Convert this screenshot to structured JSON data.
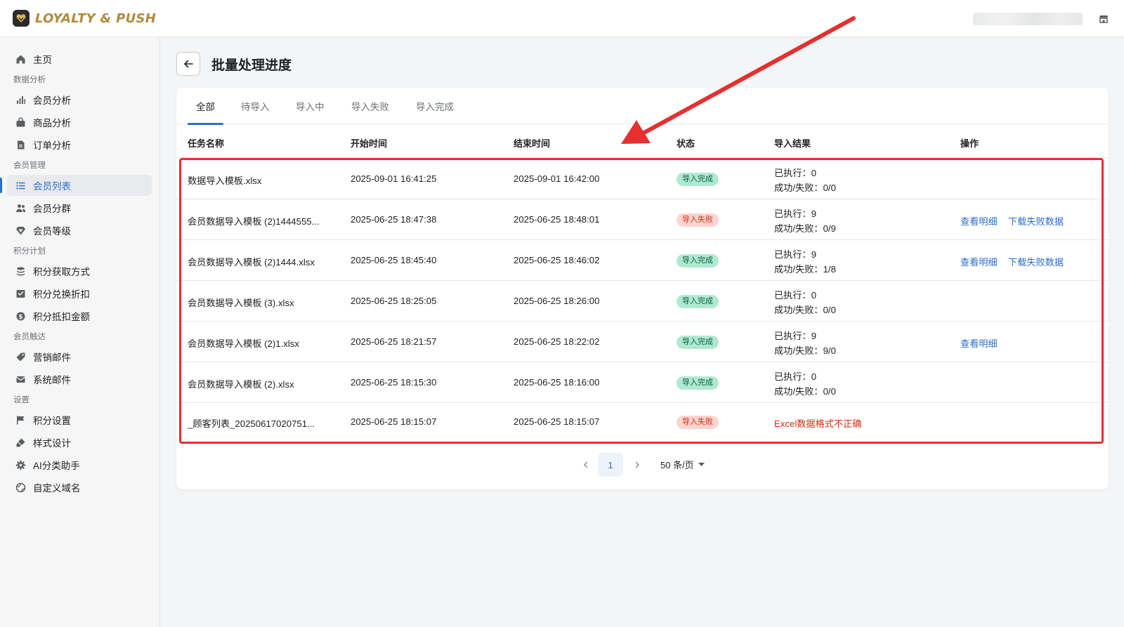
{
  "app": {
    "logo_text": "LOYALTY & PUSH",
    "user_name_redacted": ""
  },
  "sidebar": {
    "items": [
      {
        "label": "主页",
        "icon": "home-icon"
      },
      {
        "group": "数据分析"
      },
      {
        "label": "会员分析",
        "icon": "bar-chart-icon"
      },
      {
        "label": "商品分析",
        "icon": "bag-icon"
      },
      {
        "label": "订单分析",
        "icon": "document-icon"
      },
      {
        "group": "会员管理"
      },
      {
        "label": "会员列表",
        "icon": "list-icon",
        "active": true
      },
      {
        "label": "会员分群",
        "icon": "users-icon"
      },
      {
        "label": "会员等级",
        "icon": "diamond-icon"
      },
      {
        "group": "积分计划"
      },
      {
        "label": "积分获取方式",
        "icon": "stack-icon"
      },
      {
        "label": "积分兑换折扣",
        "icon": "inbox-icon"
      },
      {
        "label": "积分抵扣金额",
        "icon": "dollar-icon"
      },
      {
        "group": "会员触达"
      },
      {
        "label": "营销邮件",
        "icon": "tag-icon"
      },
      {
        "label": "系统邮件",
        "icon": "mail-icon"
      },
      {
        "group": "设置"
      },
      {
        "label": "积分设置",
        "icon": "flag-icon"
      },
      {
        "label": "样式设计",
        "icon": "brush-icon"
      },
      {
        "label": "AI分类助手",
        "icon": "gear-icon"
      },
      {
        "label": "自定义域名",
        "icon": "globe-icon"
      }
    ]
  },
  "page": {
    "title": "批量处理进度"
  },
  "tabs": [
    {
      "label": "全部",
      "active": true
    },
    {
      "label": "待导入"
    },
    {
      "label": "导入中"
    },
    {
      "label": "导入失败"
    },
    {
      "label": "导入完成"
    }
  ],
  "table": {
    "columns": [
      "任务名称",
      "开始时间",
      "结束时间",
      "状态",
      "导入结果",
      "操作"
    ],
    "rows": [
      {
        "name": "数据导入模板.xlsx",
        "start": "2025-09-01 16:41:25",
        "end": "2025-09-01 16:42:00",
        "status": "导入完成",
        "status_type": "ok",
        "executed": "已执行：0",
        "success_fail": "成功/失败：0/0",
        "actions": []
      },
      {
        "name": "会员数据导入模板 (2)1444555...",
        "start": "2025-06-25 18:47:38",
        "end": "2025-06-25 18:48:01",
        "status": "导入失败",
        "status_type": "fail",
        "executed": "已执行：9",
        "success_fail": "成功/失败：0/9",
        "actions": [
          "查看明细",
          "下载失败数据"
        ]
      },
      {
        "name": "会员数据导入模板 (2)1444.xlsx",
        "start": "2025-06-25 18:45:40",
        "end": "2025-06-25 18:46:02",
        "status": "导入完成",
        "status_type": "ok",
        "executed": "已执行：9",
        "success_fail": "成功/失败：1/8",
        "actions": [
          "查看明细",
          "下载失败数据"
        ]
      },
      {
        "name": "会员数据导入模板 (3).xlsx",
        "start": "2025-06-25 18:25:05",
        "end": "2025-06-25 18:26:00",
        "status": "导入完成",
        "status_type": "ok",
        "executed": "已执行：0",
        "success_fail": "成功/失败：0/0",
        "actions": []
      },
      {
        "name": "会员数据导入模板 (2)1.xlsx",
        "start": "2025-06-25 18:21:57",
        "end": "2025-06-25 18:22:02",
        "status": "导入完成",
        "status_type": "ok",
        "executed": "已执行：9",
        "success_fail": "成功/失败：9/0",
        "actions": [
          "查看明细"
        ]
      },
      {
        "name": "会员数据导入模板 (2).xlsx",
        "start": "2025-06-25 18:15:30",
        "end": "2025-06-25 18:16:00",
        "status": "导入完成",
        "status_type": "ok",
        "executed": "已执行：0",
        "success_fail": "成功/失败：0/0",
        "actions": []
      },
      {
        "name": "_顾客列表_20250617020751...",
        "start": "2025-06-25 18:15:07",
        "end": "2025-06-25 18:15:07",
        "status": "导入失败",
        "status_type": "fail",
        "error": "Excel数据格式不正确",
        "actions": []
      }
    ]
  },
  "pagination": {
    "current_page": "1",
    "page_size": "50 条/页"
  },
  "colors": {
    "accent": "#2c6ecb",
    "annotation": "#e5302f",
    "badge_ok_bg": "#aee9d1",
    "badge_fail_bg": "#fed3d1"
  }
}
